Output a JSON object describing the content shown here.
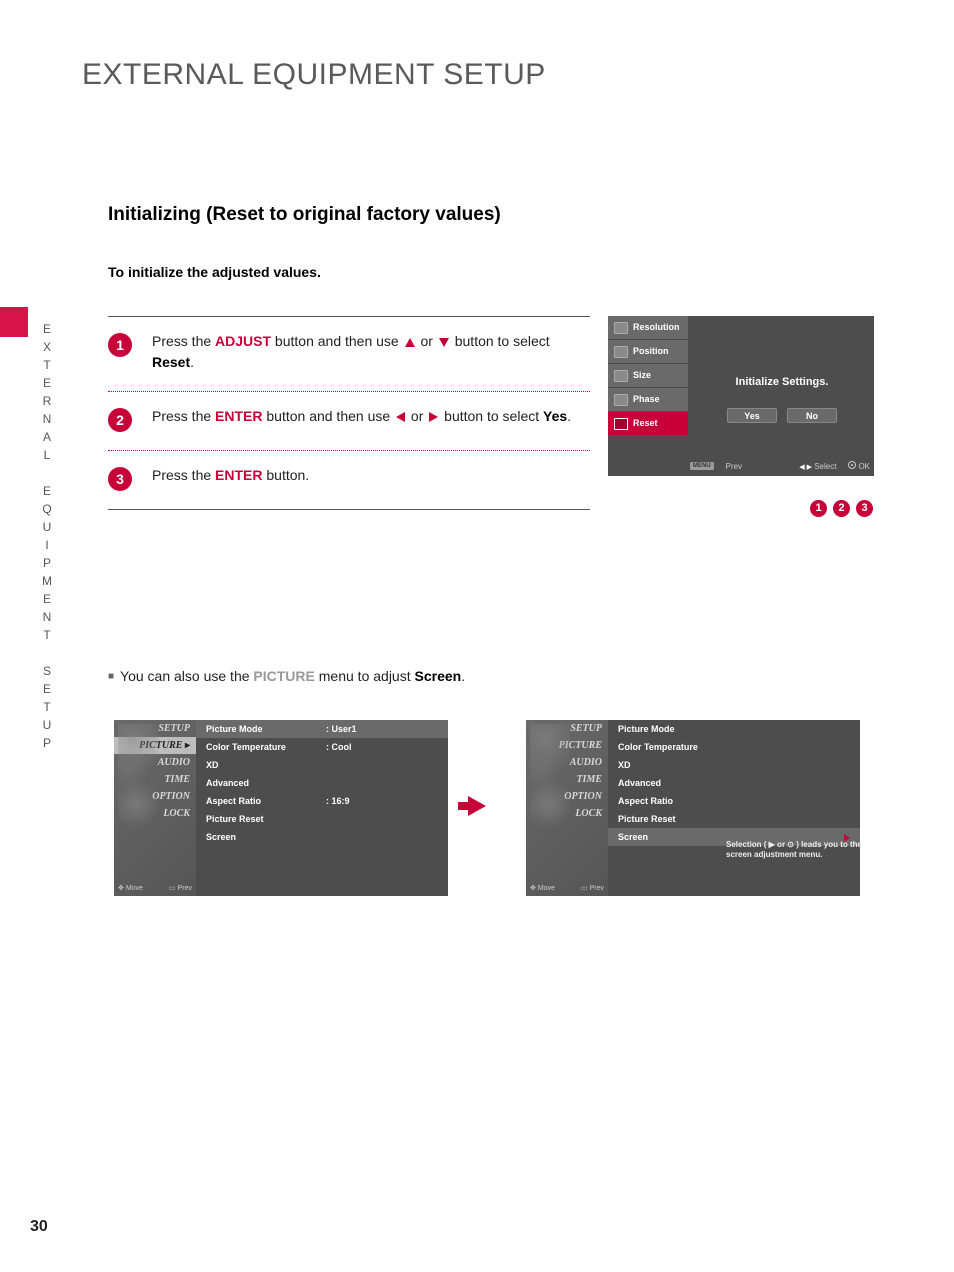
{
  "page": {
    "title": "EXTERNAL EQUIPMENT SETUP",
    "side_label": "EXTERNAL EQUIPMENT SETUP",
    "number": "30"
  },
  "section": {
    "heading": "Initializing (Reset to original factory values)",
    "sub": "To initialize the adjusted values."
  },
  "steps": [
    {
      "num": "1",
      "pre": "Press the ",
      "btn": "ADJUST",
      "mid": " button and then use ",
      "dir": "updown",
      "post": " button to select ",
      "target": "Reset",
      "tail": "."
    },
    {
      "num": "2",
      "pre": "Press the ",
      "btn": "ENTER",
      "mid": " button and then use ",
      "dir": "leftright",
      "post": " button to select ",
      "target": "Yes",
      "tail": "."
    },
    {
      "num": "3",
      "pre": "Press the ",
      "btn": "ENTER",
      "mid": " button.",
      "dir": "",
      "post": "",
      "target": "",
      "tail": ""
    }
  ],
  "osd": {
    "items": [
      "Resolution",
      "Position",
      "Size",
      "Phase",
      "Reset"
    ],
    "selected": "Reset",
    "title": "Initialize Settings.",
    "yes": "Yes",
    "no": "No",
    "footer": {
      "menu": "MENU",
      "prev": "Prev",
      "select": "Select",
      "ok": "OK"
    }
  },
  "small_badges": [
    "1",
    "2",
    "3"
  ],
  "note": {
    "pre": "You can also use the ",
    "menu": "PICTURE",
    "mid": " menu to adjust ",
    "target": "Screen",
    "tail": "."
  },
  "picture_menu": {
    "side": [
      "SETUP",
      "PICTURE",
      "AUDIO",
      "TIME",
      "OPTION",
      "LOCK"
    ],
    "side_footer_move": "Move",
    "side_footer_prev": "Prev",
    "rows": [
      {
        "label": "Picture Mode",
        "value": ": User1"
      },
      {
        "label": "Color Temperature",
        "value": ": Cool"
      },
      {
        "label": "XD",
        "value": ""
      },
      {
        "label": "Advanced",
        "value": ""
      },
      {
        "label": "Aspect Ratio",
        "value": ": 16:9"
      },
      {
        "label": "Picture Reset",
        "value": ""
      },
      {
        "label": "Screen",
        "value": ""
      }
    ],
    "hint": "Selection ( ▶ or ⊙ ) leads you to the screen adjustment menu."
  }
}
